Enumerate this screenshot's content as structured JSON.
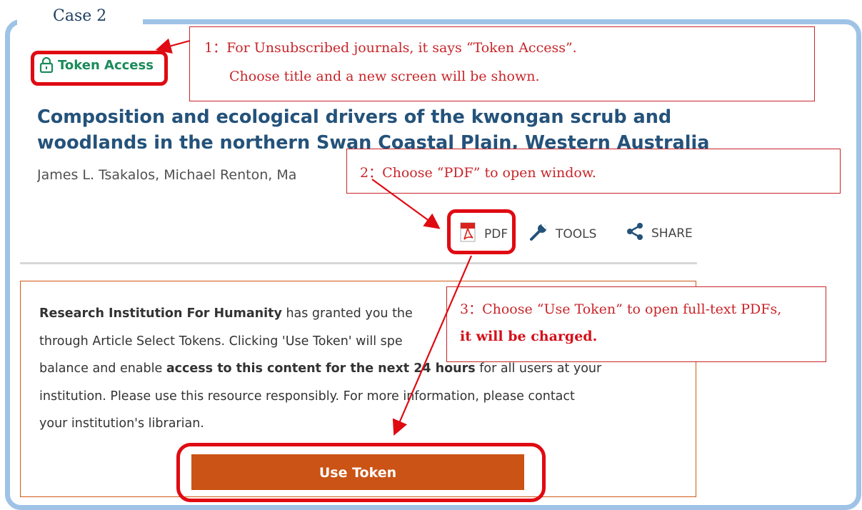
{
  "case_label": "Case 2",
  "token_access_label": "Token Access",
  "article": {
    "title": "Composition and ecological drivers of the kwongan scrub and woodlands in the northern Swan Coastal Plain, Western Australia",
    "authors": "James L. Tsakalos,  Michael Renton,  Ma"
  },
  "actions": {
    "pdf": "PDF",
    "tools": "TOOLS",
    "share": "SHARE"
  },
  "token_notice": {
    "institution": "Research Institution For Humanity",
    "text_a": " has granted you the ",
    "text_b": "through Article Select Tokens. Clicking 'Use Token' will spe",
    "text_c": "balance and enable ",
    "bold_access": "access to this content for the next 24 hours",
    "text_d": " for all users at your",
    "text_e": "institution. Please use this resource responsibly. For more information, please contact",
    "text_f": "your institution's librarian.",
    "button": "Use Token"
  },
  "annotations": {
    "note1_line1": "1：For Unsubscribed journals, it says “Token Access”.",
    "note1_line2": "Choose title and a new screen will be shown.",
    "note2": "2：Choose “PDF” to open window.",
    "note3_line1": "3：Choose “Use Token” to open full-text PDFs,",
    "note3_line2": "it will be charged."
  },
  "colors": {
    "frame": "#9ec3e6",
    "annotation_red": "#c8252a",
    "highlight_red": "#e00a12",
    "title_blue": "#24527a",
    "token_green": "#1b8a5a",
    "button_orange": "#ca5315"
  },
  "icons": {
    "lock": "lock-icon",
    "pdf": "pdf-file-icon",
    "tools": "wrench-icon",
    "share": "share-icon"
  }
}
